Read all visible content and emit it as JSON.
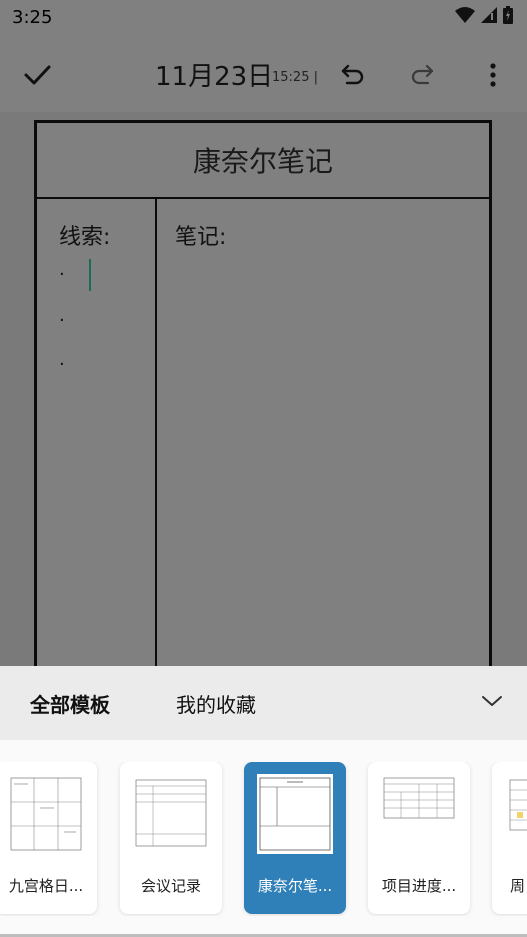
{
  "status_bar": {
    "time": "3:25"
  },
  "toolbar": {
    "date": "11月23日",
    "time": "15:25",
    "time_tail": "|"
  },
  "note": {
    "title": "康奈尔笔记",
    "clues_label": "线索:",
    "notes_label": "笔记:",
    "bullets": [
      ".",
      ".",
      "."
    ]
  },
  "panel": {
    "tabs": [
      {
        "label": "全部模板",
        "active": true
      },
      {
        "label": "我的收藏",
        "active": false
      }
    ],
    "templates": [
      {
        "label": "九宫格日..."
      },
      {
        "label": "会议记录"
      },
      {
        "label": "康奈尔笔...",
        "selected": true
      },
      {
        "label": "项目进度..."
      },
      {
        "label": "周"
      }
    ]
  },
  "colors": {
    "overlay": "#808080",
    "selected": "#2f7fb8",
    "cursor": "#1b6b5a"
  }
}
